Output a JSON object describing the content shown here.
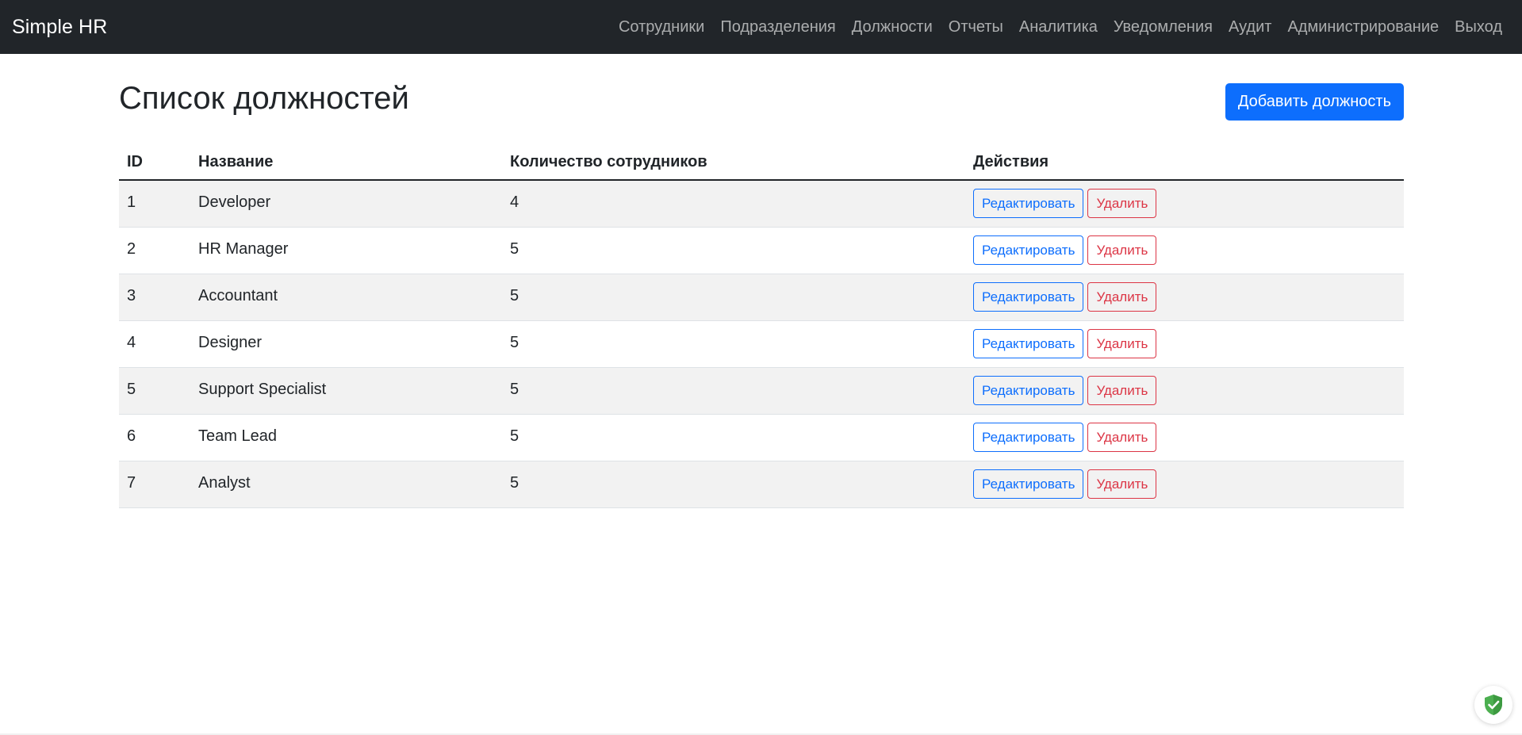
{
  "navbar": {
    "brand": "Simple HR",
    "links": [
      "Сотрудники",
      "Подразделения",
      "Должности",
      "Отчеты",
      "Аналитика",
      "Уведомления",
      "Аудит",
      "Администрирование",
      "Выход"
    ]
  },
  "page": {
    "title": "Список должностей",
    "add_button": "Добавить должность"
  },
  "table": {
    "headers": [
      "ID",
      "Название",
      "Количество сотрудников",
      "Действия"
    ],
    "edit_label": "Редактировать",
    "delete_label": "Удалить",
    "rows": [
      {
        "id": "1",
        "name": "Developer",
        "count": "4"
      },
      {
        "id": "2",
        "name": "HR Manager",
        "count": "5"
      },
      {
        "id": "3",
        "name": "Accountant",
        "count": "5"
      },
      {
        "id": "4",
        "name": "Designer",
        "count": "5"
      },
      {
        "id": "5",
        "name": "Support Specialist",
        "count": "5"
      },
      {
        "id": "6",
        "name": "Team Lead",
        "count": "5"
      },
      {
        "id": "7",
        "name": "Analyst",
        "count": "5"
      }
    ]
  },
  "icons": {
    "badge": "shield-check-icon"
  },
  "colors": {
    "navbar_bg": "#212529",
    "primary": "#0d6efd",
    "danger": "#dc3545",
    "stripe": "#f2f2f2",
    "shield_green": "#4caf50"
  }
}
